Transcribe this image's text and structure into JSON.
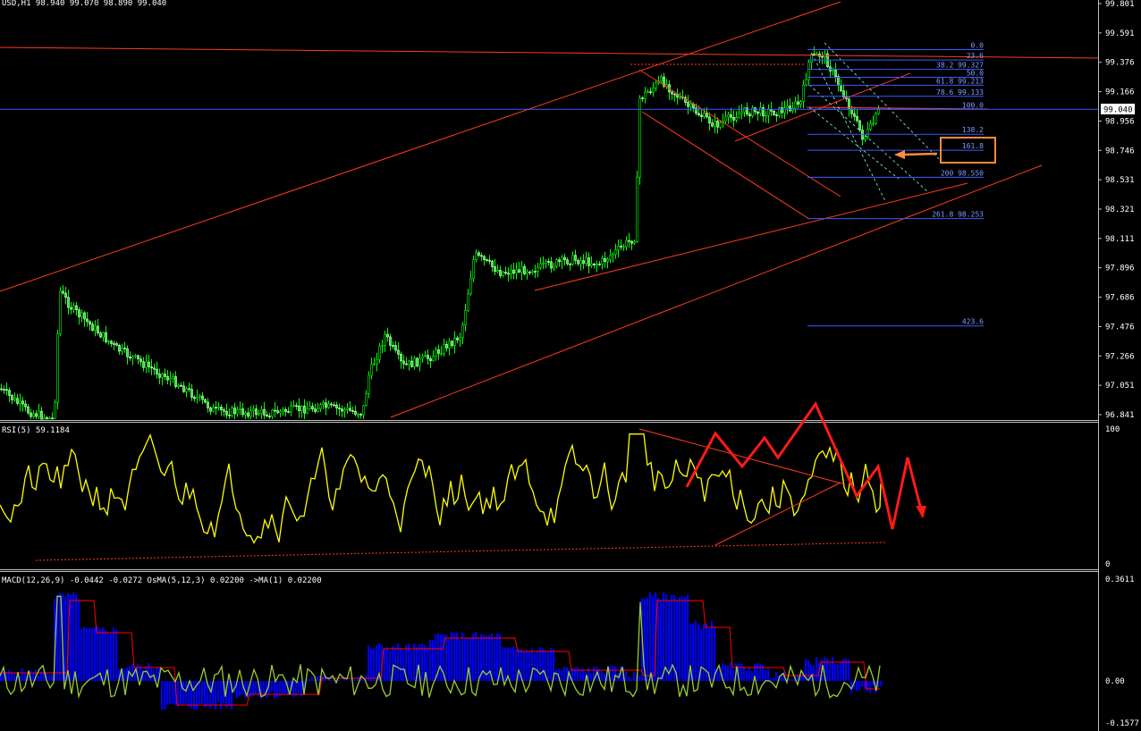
{
  "price_pane": {
    "header": "USD,H1  98.940 99.070 98.890 99.040",
    "y_ticks": [
      "99.801",
      "99.591",
      "99.376",
      "99.166",
      "98.956",
      "98.746",
      "98.531",
      "98.321",
      "98.111",
      "97.896",
      "97.686",
      "97.476",
      "97.266",
      "97.051",
      "96.841"
    ],
    "current_price": "99.040",
    "ylim": [
      96.841,
      99.801
    ],
    "fib_levels": [
      {
        "label": "0.0",
        "price": 99.47
      },
      {
        "label": "23.6",
        "price": 99.395
      },
      {
        "label": "38.2 99.327",
        "price": 99.327
      },
      {
        "label": "50.0",
        "price": 99.27
      },
      {
        "label": "61.8 99.213",
        "price": 99.213
      },
      {
        "label": "78.6 99.133",
        "price": 99.133
      },
      {
        "label": "100.0",
        "price": 99.04
      },
      {
        "label": "138.2",
        "price": 98.86
      },
      {
        "label": "161.8",
        "price": 98.745
      },
      {
        "label": "200 98.550",
        "price": 98.55
      },
      {
        "label": "261.8 98.253",
        "price": 98.253
      },
      {
        "label": "423.6",
        "price": 97.48
      }
    ],
    "colors": {
      "up": "#00ff00",
      "down": "#ffffff",
      "trend": "#ff3b1f",
      "fib": "#3b5bff",
      "highlight": "#ff8c3a"
    }
  },
  "rsi_pane": {
    "header": "RSI(5) 59.1184",
    "y_ticks": [
      "100",
      "0"
    ],
    "color": "#ffff00"
  },
  "macd_pane": {
    "header": "MACD(12,26,9) -0.0442 -0.0272  OsMA(5,12,3) 0.02200  ->MA(1) 0.02200",
    "y_ticks": [
      "0.3611",
      "0.00",
      "-0.1577"
    ],
    "colors": {
      "histogram": "#0000ff",
      "signal": "#ff0000",
      "osma": "#9acd32"
    }
  },
  "chart_data": {
    "type": "line",
    "title": "USD,H1",
    "series": [
      {
        "name": "RSI(5)",
        "values": [
          59.1184
        ]
      },
      {
        "name": "MACD(12,26,9)",
        "values": [
          -0.0442,
          -0.0272
        ]
      },
      {
        "name": "OsMA(5,12,3)",
        "values": [
          0.022
        ]
      }
    ],
    "ylim_price": [
      96.841,
      99.801
    ],
    "ylim_rsi": [
      0,
      100
    ],
    "ylim_macd": [
      -0.1577,
      0.3611
    ],
    "grid": false
  }
}
